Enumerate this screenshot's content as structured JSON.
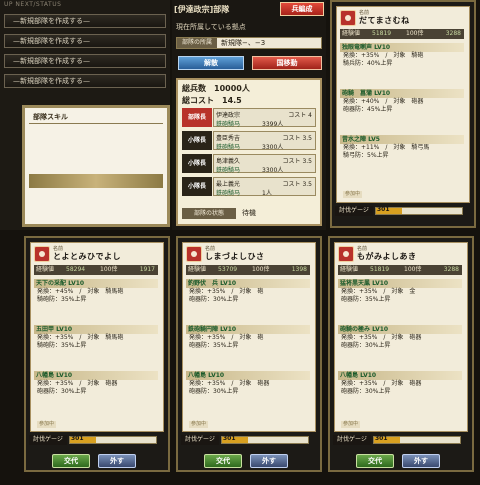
{
  "sidebar": {
    "header": "UP NEXT/STATUS",
    "new_slots": [
      "—新規部隊を作成する—",
      "—新規部隊を作成する—",
      "—新規部隊を作成する—",
      "—新規部隊を作成する—"
    ],
    "skill_title": "部隊スキル"
  },
  "unit": {
    "title": "[伊達政宗]部隊",
    "hensei_button": "兵編成",
    "location_text": "現在所属している拠点",
    "location_label": "部隊の所属",
    "location_value": "新規隊−、−3",
    "disband_button": "解散",
    "move_button": "国移動",
    "total_soldiers": "総兵数　10000人",
    "total_cost": "総コスト　14.5",
    "members": [
      {
        "role": "部隊長",
        "name": "伊達政宗",
        "cost": "コスト 4",
        "type": "鉄砲騎马",
        "count": "3399人",
        "role_color": "#b8322a"
      },
      {
        "role": "小隊長",
        "name": "豊臣秀吉",
        "cost": "コスト 3.5",
        "type": "鉄砲騎马",
        "count": "3300人",
        "role_color": "#2a2418"
      },
      {
        "role": "小隊長",
        "name": "島津義久",
        "cost": "コスト 3.5",
        "type": "鉄砲騎马",
        "count": "3300人",
        "role_color": "#2a2418"
      },
      {
        "role": "小隊長",
        "name": "最上義光",
        "cost": "コスト 3.5",
        "type": "鉄砲騎马",
        "count": "1人",
        "role_color": "#2a2418"
      }
    ],
    "status_label": "部隊の状態",
    "status_value": "待機"
  },
  "cards": [
    {
      "name_label": "名前",
      "name": "だてまさむね",
      "exp_label": "経験値",
      "exp": "51819",
      "lv_label": "100倖",
      "lv": "3288",
      "skills": [
        {
          "title": "独眼竜喇声 LV10",
          "line1": "発換：+35%　/　対象　騎砲",
          "line2": "騎兵防：40%上昇"
        },
        {
          "title": "砲騎　菖蒲 LV10",
          "line1": "発換：+40%　/　対象　砲器",
          "line2": "砲器防：45%上昇"
        },
        {
          "title": "昔水之陣 LV5",
          "line1": "発換：+11%　/　対象　騎弓馬",
          "line2": "騎弓防：5%上昇"
        }
      ],
      "badge": "参加中",
      "gauge_label": "討伐ゲージ",
      "gauge_value": "301",
      "gauge_fraction": 0.3
    },
    {
      "name_label": "名前",
      "name": "とよとみひでよし",
      "exp_label": "経験値",
      "exp": "58294",
      "lv_label": "100倖",
      "lv": "1917",
      "skills": [
        {
          "title": "天下の采配 LV10",
          "line1": "発換：+45%　/　対象　騎馬砲",
          "line2": "騎砲防：35%上昇"
        },
        {
          "title": "五田甲 LV10",
          "line1": "発換：+35%　/　対象　騎馬砲",
          "line2": "騎砲防：35%上昇"
        },
        {
          "title": "八幡島 LV10",
          "line1": "発換：+35%　/　対象　砲器",
          "line2": "砲器防：30%上昇"
        }
      ],
      "badge": "参加中",
      "gauge_label": "討伐ゲージ",
      "gauge_value": "301",
      "gauge_fraction": 0.3,
      "swap": "交代",
      "remove": "外す"
    },
    {
      "name_label": "名前",
      "name": "しまづよしひさ",
      "exp_label": "経験値",
      "exp": "53709",
      "lv_label": "100倖",
      "lv": "1398",
      "skills": [
        {
          "title": "釣野伏　兵 LV10",
          "line1": "発換：+35%　/　対象　砲",
          "line2": "砲器防：30%上昇"
        },
        {
          "title": "鉄砲騎円陣 LV10",
          "line1": "発換：+35%　/　対象　砲",
          "line2": "砲器防：35%上昇"
        },
        {
          "title": "八幡島 LV10",
          "line1": "発換：+35%　/　対象　砲器",
          "line2": "砲器防：30%上昇"
        }
      ],
      "badge": "参加中",
      "gauge_label": "討伐ゲージ",
      "gauge_value": "301",
      "gauge_fraction": 0.3,
      "swap": "交代",
      "remove": "外す"
    },
    {
      "name_label": "名前",
      "name": "もがみよしあき",
      "exp_label": "経験値",
      "exp": "51819",
      "lv_label": "100倖",
      "lv": "3288",
      "skills": [
        {
          "title": "猛将黒天鳳 LV10",
          "line1": "発換：+35%　/　対象　金",
          "line2": "砲器防：35%上昇"
        },
        {
          "title": "砲騎の極み LV10",
          "line1": "発換：+35%　/　対象　砲器",
          "line2": "砲器防：30%上昇"
        },
        {
          "title": "八幡島 LV10",
          "line1": "発換：+35%　/　対象　砲器",
          "line2": "砲器防：30%上昇"
        }
      ],
      "badge": "参加中",
      "gauge_label": "討伐ゲージ",
      "gauge_value": "301",
      "gauge_fraction": 0.3,
      "swap": "交代",
      "remove": "外す"
    }
  ]
}
